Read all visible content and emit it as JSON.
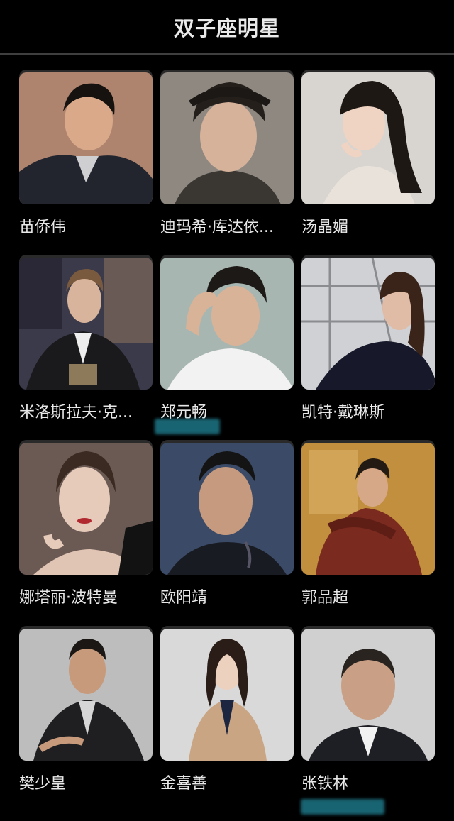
{
  "header": {
    "title": "双子座明星"
  },
  "celebrities": [
    {
      "name": "苗侨伟"
    },
    {
      "name": "迪玛希·库达依..."
    },
    {
      "name": "汤晶媚"
    },
    {
      "name": "米洛斯拉夫·克..."
    },
    {
      "name": "郑元畅"
    },
    {
      "name": "凯特·戴琳斯"
    },
    {
      "name": "娜塔丽·波特曼"
    },
    {
      "name": "欧阳靖"
    },
    {
      "name": "郭品超"
    },
    {
      "name": "樊少皇"
    },
    {
      "name": "金喜善"
    },
    {
      "name": "张铁林"
    }
  ]
}
